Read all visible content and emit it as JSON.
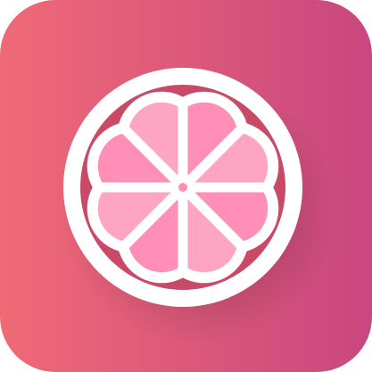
{
  "app_icon": {
    "icon_name": "citrus-slice-icon",
    "colors": {
      "background_gradient_start": "#EF6A76",
      "background_gradient_end": "#C9477F",
      "ring": "#FFFFFF",
      "inner_disc": "#C94A67",
      "segments_main": "#FF8FB6",
      "segments_light": "#FFA5C4",
      "dividers": "#FFFFFF"
    }
  }
}
